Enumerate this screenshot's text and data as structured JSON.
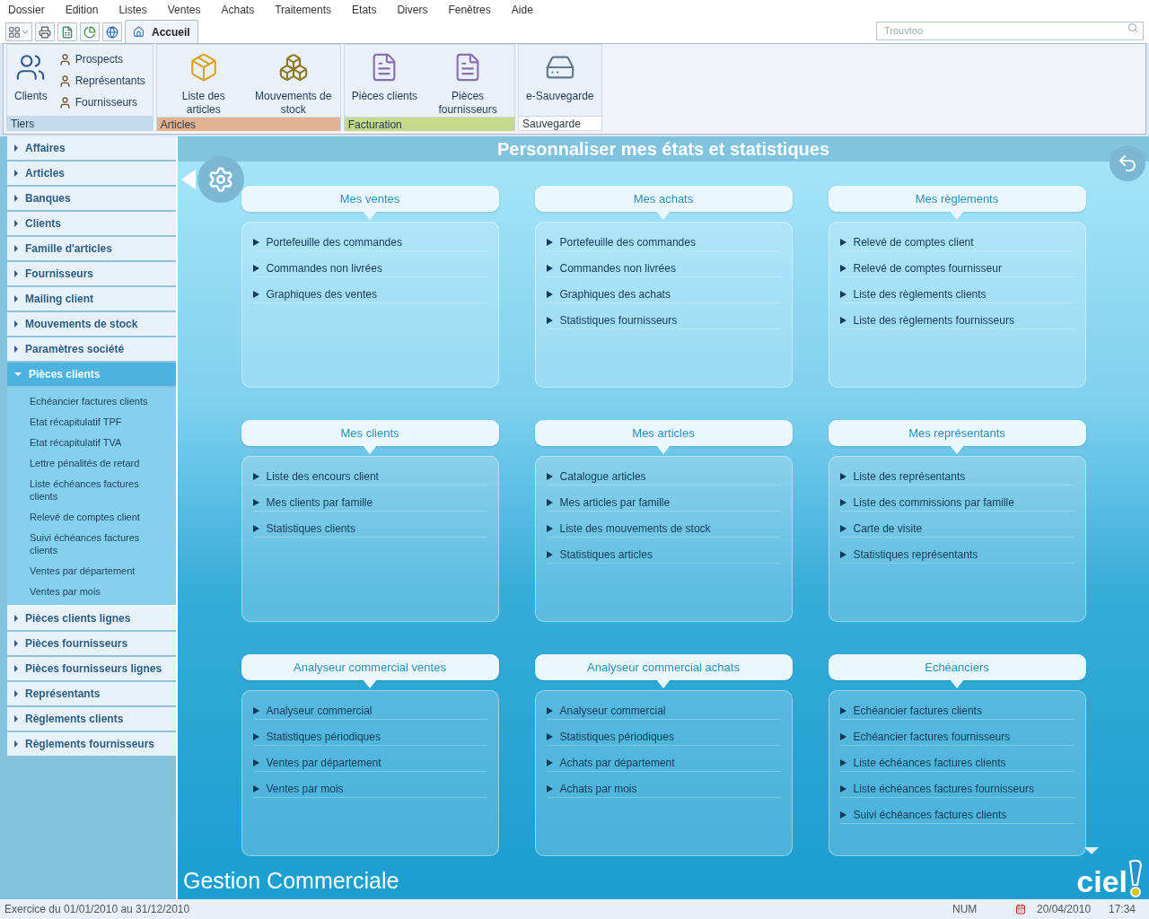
{
  "menu": [
    "Dossier",
    "Edition",
    "Listes",
    "Ventes",
    "Achats",
    "Traitements",
    "Etats",
    "Divers",
    "Fenêtres",
    "Aide"
  ],
  "tabs": [
    {
      "label": "Accueil",
      "selected": true
    }
  ],
  "search": {
    "placeholder": "Trouvtoo"
  },
  "ribbon": [
    {
      "label": "Tiers",
      "color": "#c2dcee",
      "buttons": [
        {
          "label": "Clients",
          "kind": "large"
        },
        {
          "label": "Prospects",
          "kind": "small"
        },
        {
          "label": "Représentants",
          "kind": "small"
        },
        {
          "label": "Fournisseurs",
          "kind": "small"
        }
      ]
    },
    {
      "label": "Articles",
      "color": "#e3b291",
      "buttons": [
        {
          "label": "Liste des articles",
          "kind": "large"
        },
        {
          "label": "Mouvements de stock",
          "kind": "large"
        }
      ]
    },
    {
      "label": "Facturation",
      "color": "#c5d98c",
      "buttons": [
        {
          "label": "Pièces clients",
          "kind": "large"
        },
        {
          "label": "Pièces fournisseurs",
          "kind": "large"
        }
      ]
    },
    {
      "label": "Sauvegarde",
      "color": "#ffffff",
      "buttons": [
        {
          "label": "e-Sauvegarde",
          "kind": "large"
        }
      ]
    }
  ],
  "sidebar": [
    {
      "label": "Affaires",
      "expanded": false
    },
    {
      "label": "Articles",
      "expanded": false
    },
    {
      "label": "Banques",
      "expanded": false
    },
    {
      "label": "Clients",
      "expanded": false
    },
    {
      "label": "Famille d'articles",
      "expanded": false
    },
    {
      "label": "Fournisseurs",
      "expanded": false
    },
    {
      "label": "Mailing client",
      "expanded": false
    },
    {
      "label": "Mouvements de stock",
      "expanded": false
    },
    {
      "label": "Paramètres société",
      "expanded": false
    },
    {
      "label": "Pièces clients",
      "expanded": true,
      "children": [
        "Echéancier factures clients",
        "Etat récapitulatif TPF",
        "Etat récapitulatif TVA",
        "Lettre pénalités de retard",
        "Liste échéances factures clients",
        "Relevé de comptes client",
        "Suivi échéances factures clients",
        "Ventes par département",
        "Ventes par mois"
      ]
    },
    {
      "label": "Pièces clients lignes",
      "expanded": false
    },
    {
      "label": "Pièces fournisseurs",
      "expanded": false
    },
    {
      "label": "Pièces fournisseurs lignes",
      "expanded": false
    },
    {
      "label": "Représentants",
      "expanded": false
    },
    {
      "label": "Règlements clients",
      "expanded": false
    },
    {
      "label": "Règlements fournisseurs",
      "expanded": false
    }
  ],
  "main": {
    "title": "Personnaliser mes états et statistiques",
    "footer": "Gestion Commerciale",
    "logo": "ciel",
    "panels": [
      {
        "title": "Mes ventes",
        "items": [
          "Portefeuille des commandes",
          "Commandes non livrées",
          "Graphiques des ventes"
        ]
      },
      {
        "title": "Mes achats",
        "items": [
          "Portefeuille des commandes",
          "Commandes non livrées",
          "Graphiques des achats",
          "Statistiques fournisseurs"
        ]
      },
      {
        "title": "Mes règlements",
        "items": [
          "Relevé de comptes client",
          "Relevé de comptes fournisseur",
          "Liste des règlements clients",
          "Liste des règlements fournisseurs"
        ]
      },
      {
        "title": "Mes clients",
        "items": [
          "Liste des encours client",
          "Mes clients par famille",
          "Statistiques clients"
        ]
      },
      {
        "title": "Mes articles",
        "items": [
          "Catalogue articles",
          "Mes articles par famille",
          "Liste des mouvements de stock",
          "Statistiques articles"
        ]
      },
      {
        "title": "Mes représentants",
        "items": [
          "Liste des représentants",
          "Liste des commissions par famille",
          "Carte de visite",
          "Statistiques représentants"
        ]
      },
      {
        "title": "Analyseur commercial ventes",
        "items": [
          "Analyseur commercial",
          "Statistiques périodiques",
          "Ventes par département",
          "Ventes par mois"
        ]
      },
      {
        "title": "Analyseur commercial achats",
        "items": [
          "Analyseur commercial",
          "Statistiques périodiques",
          "Achats par département",
          "Achats par mois"
        ]
      },
      {
        "title": "Echéanciers",
        "items": [
          "Echéancier factures clients",
          "Echéancier factures fournisseurs",
          "Liste échéances factures clients",
          "Liste échéances factures fournisseurs",
          "Suivi échéances factures clients"
        ]
      }
    ]
  },
  "status": {
    "period": "Exercice du 01/01/2010 au 31/12/2010",
    "num": "NUM",
    "date": "20/04/2010",
    "time": "17:34"
  }
}
